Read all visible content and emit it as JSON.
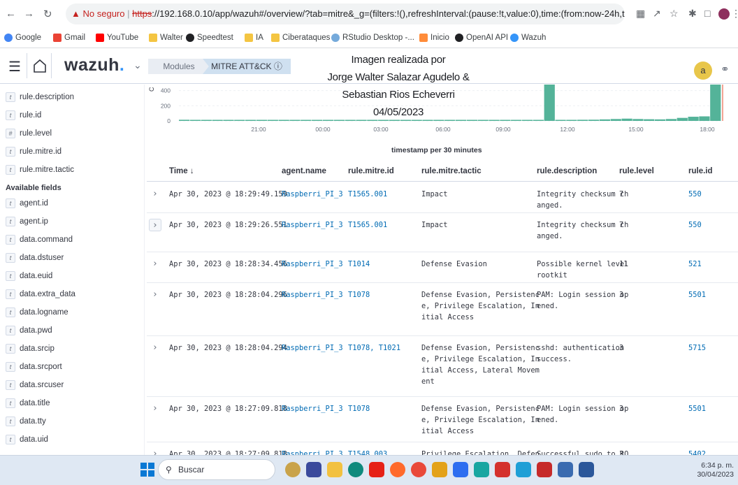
{
  "browser": {
    "security_label": "No seguro",
    "url_scheme": "https",
    "url_rest": "://192.168.0.10/app/wazuh#/overview/?tab=mitre&_g=(filters:!(),refreshInterval:(pause:!t,value:0),time:(from:now-24h,to:now))&_a=(column...",
    "bookmarks": [
      "Google",
      "Gmail",
      "YouTube",
      "Walter",
      "Speedtest",
      "IA",
      "Ciberataques",
      "RStudio Desktop -...",
      "Inicio",
      "OpenAI API",
      "Wazuh"
    ]
  },
  "header": {
    "logo": "wazuh",
    "breadcrumb_modules": "Modules",
    "breadcrumb_current": "MITRE ATT&CK ⓘ",
    "avatar_letter": "a"
  },
  "caption": {
    "line1": "Imagen realizada por",
    "line2": "Jorge Walter Salazar Agudelo &",
    "line3": "Sebastian Rios Echeverri",
    "line4": "04/05/2023"
  },
  "sidebar": {
    "selected_fields": [
      {
        "type": "t",
        "name": "rule.description"
      },
      {
        "type": "t",
        "name": "rule.id"
      },
      {
        "type": "#",
        "name": "rule.level"
      },
      {
        "type": "t",
        "name": "rule.mitre.id"
      },
      {
        "type": "t",
        "name": "rule.mitre.tactic"
      }
    ],
    "available_title": "Available fields",
    "available_fields": [
      {
        "type": "t",
        "name": "agent.id"
      },
      {
        "type": "t",
        "name": "agent.ip"
      },
      {
        "type": "t",
        "name": "data.command"
      },
      {
        "type": "t",
        "name": "data.dstuser"
      },
      {
        "type": "t",
        "name": "data.euid"
      },
      {
        "type": "t",
        "name": "data.extra_data"
      },
      {
        "type": "t",
        "name": "data.logname"
      },
      {
        "type": "t",
        "name": "data.pwd"
      },
      {
        "type": "t",
        "name": "data.srcip"
      },
      {
        "type": "t",
        "name": "data.srcport"
      },
      {
        "type": "t",
        "name": "data.srcuser"
      },
      {
        "type": "t",
        "name": "data.title"
      },
      {
        "type": "t",
        "name": "data.tty"
      },
      {
        "type": "t",
        "name": "data.uid"
      }
    ]
  },
  "chart_data": {
    "type": "bar",
    "xlabel": "timestamp per 30 minutes",
    "ylabel": "Count",
    "y_ticks": [
      "0",
      "200",
      "400"
    ],
    "x_ticks": [
      "21:00",
      "00:00",
      "03:00",
      "06:00",
      "09:00",
      "12:00",
      "15:00",
      "18:00"
    ],
    "ylim": [
      0,
      480
    ],
    "grid": true,
    "color": "#54b399",
    "values": [
      15,
      14,
      14,
      14,
      14,
      14,
      14,
      14,
      14,
      14,
      14,
      14,
      14,
      14,
      14,
      14,
      14,
      14,
      14,
      14,
      14,
      14,
      14,
      14,
      14,
      14,
      14,
      14,
      14,
      14,
      14,
      14,
      14,
      480,
      14,
      14,
      15,
      16,
      20,
      25,
      30,
      25,
      22,
      20,
      25,
      40,
      55,
      60,
      480
    ]
  },
  "table": {
    "columns": [
      "Time ↓",
      "agent.name",
      "rule.mitre.id",
      "rule.mitre.tactic",
      "rule.description",
      "rule.level",
      "rule.id"
    ],
    "rows": [
      {
        "time": "Apr 30, 2023 @ 18:29:49.159",
        "agent": "Raspberri_PI_3",
        "mitre_id": "T1565.001",
        "tactic": "Impact",
        "description": "Integrity checksum ch\nanged.",
        "level": "7",
        "rule_id": "550"
      },
      {
        "time": "Apr 30, 2023 @ 18:29:26.551",
        "agent": "Raspberri_PI_3",
        "mitre_id": "T1565.001",
        "tactic": "Impact",
        "description": "Integrity checksum ch\nanged.",
        "level": "7",
        "rule_id": "550"
      },
      {
        "time": "Apr 30, 2023 @ 18:28:34.456",
        "agent": "Raspberri_PI_3",
        "mitre_id": "T1014",
        "tactic": "Defense Evasion",
        "description": "Possible kernel level\nrootkit",
        "level": "11",
        "rule_id": "521"
      },
      {
        "time": "Apr 30, 2023 @ 18:28:04.296",
        "agent": "Raspberri_PI_3",
        "mitre_id": "T1078",
        "tactic": "Defense Evasion, Persistenc\ne, Privilege Escalation, In\nitial Access",
        "description": "PAM: Login session op\nened.",
        "level": "3",
        "rule_id": "5501"
      },
      {
        "time": "Apr 30, 2023 @ 18:28:04.294",
        "agent": "Raspberri_PI_3",
        "mitre_id": "T1078, T1021",
        "tactic": "Defense Evasion, Persistenc\ne, Privilege Escalation, In\nitial Access, Lateral Movem\nent",
        "description": "sshd: authentication\nsuccess.",
        "level": "3",
        "rule_id": "5715"
      },
      {
        "time": "Apr 30, 2023 @ 18:27:09.818",
        "agent": "Raspberri_PI_3",
        "mitre_id": "T1078",
        "tactic": "Defense Evasion, Persistenc\ne, Privilege Escalation, In\nitial Access",
        "description": "PAM: Login session op\nened.",
        "level": "3",
        "rule_id": "5501"
      },
      {
        "time": "Apr 30, 2023 @ 18:27:09.818",
        "agent": "Raspberri_PI_3",
        "mitre_id": "T1548.003",
        "tactic": "Privilege Escalation, Defen",
        "description": "Successful sudo to RO",
        "level": "3",
        "rule_id": "5402"
      }
    ]
  },
  "taskbar": {
    "search_placeholder": "Buscar",
    "time": "6:34 p. m.",
    "date": "30/04/2023"
  }
}
